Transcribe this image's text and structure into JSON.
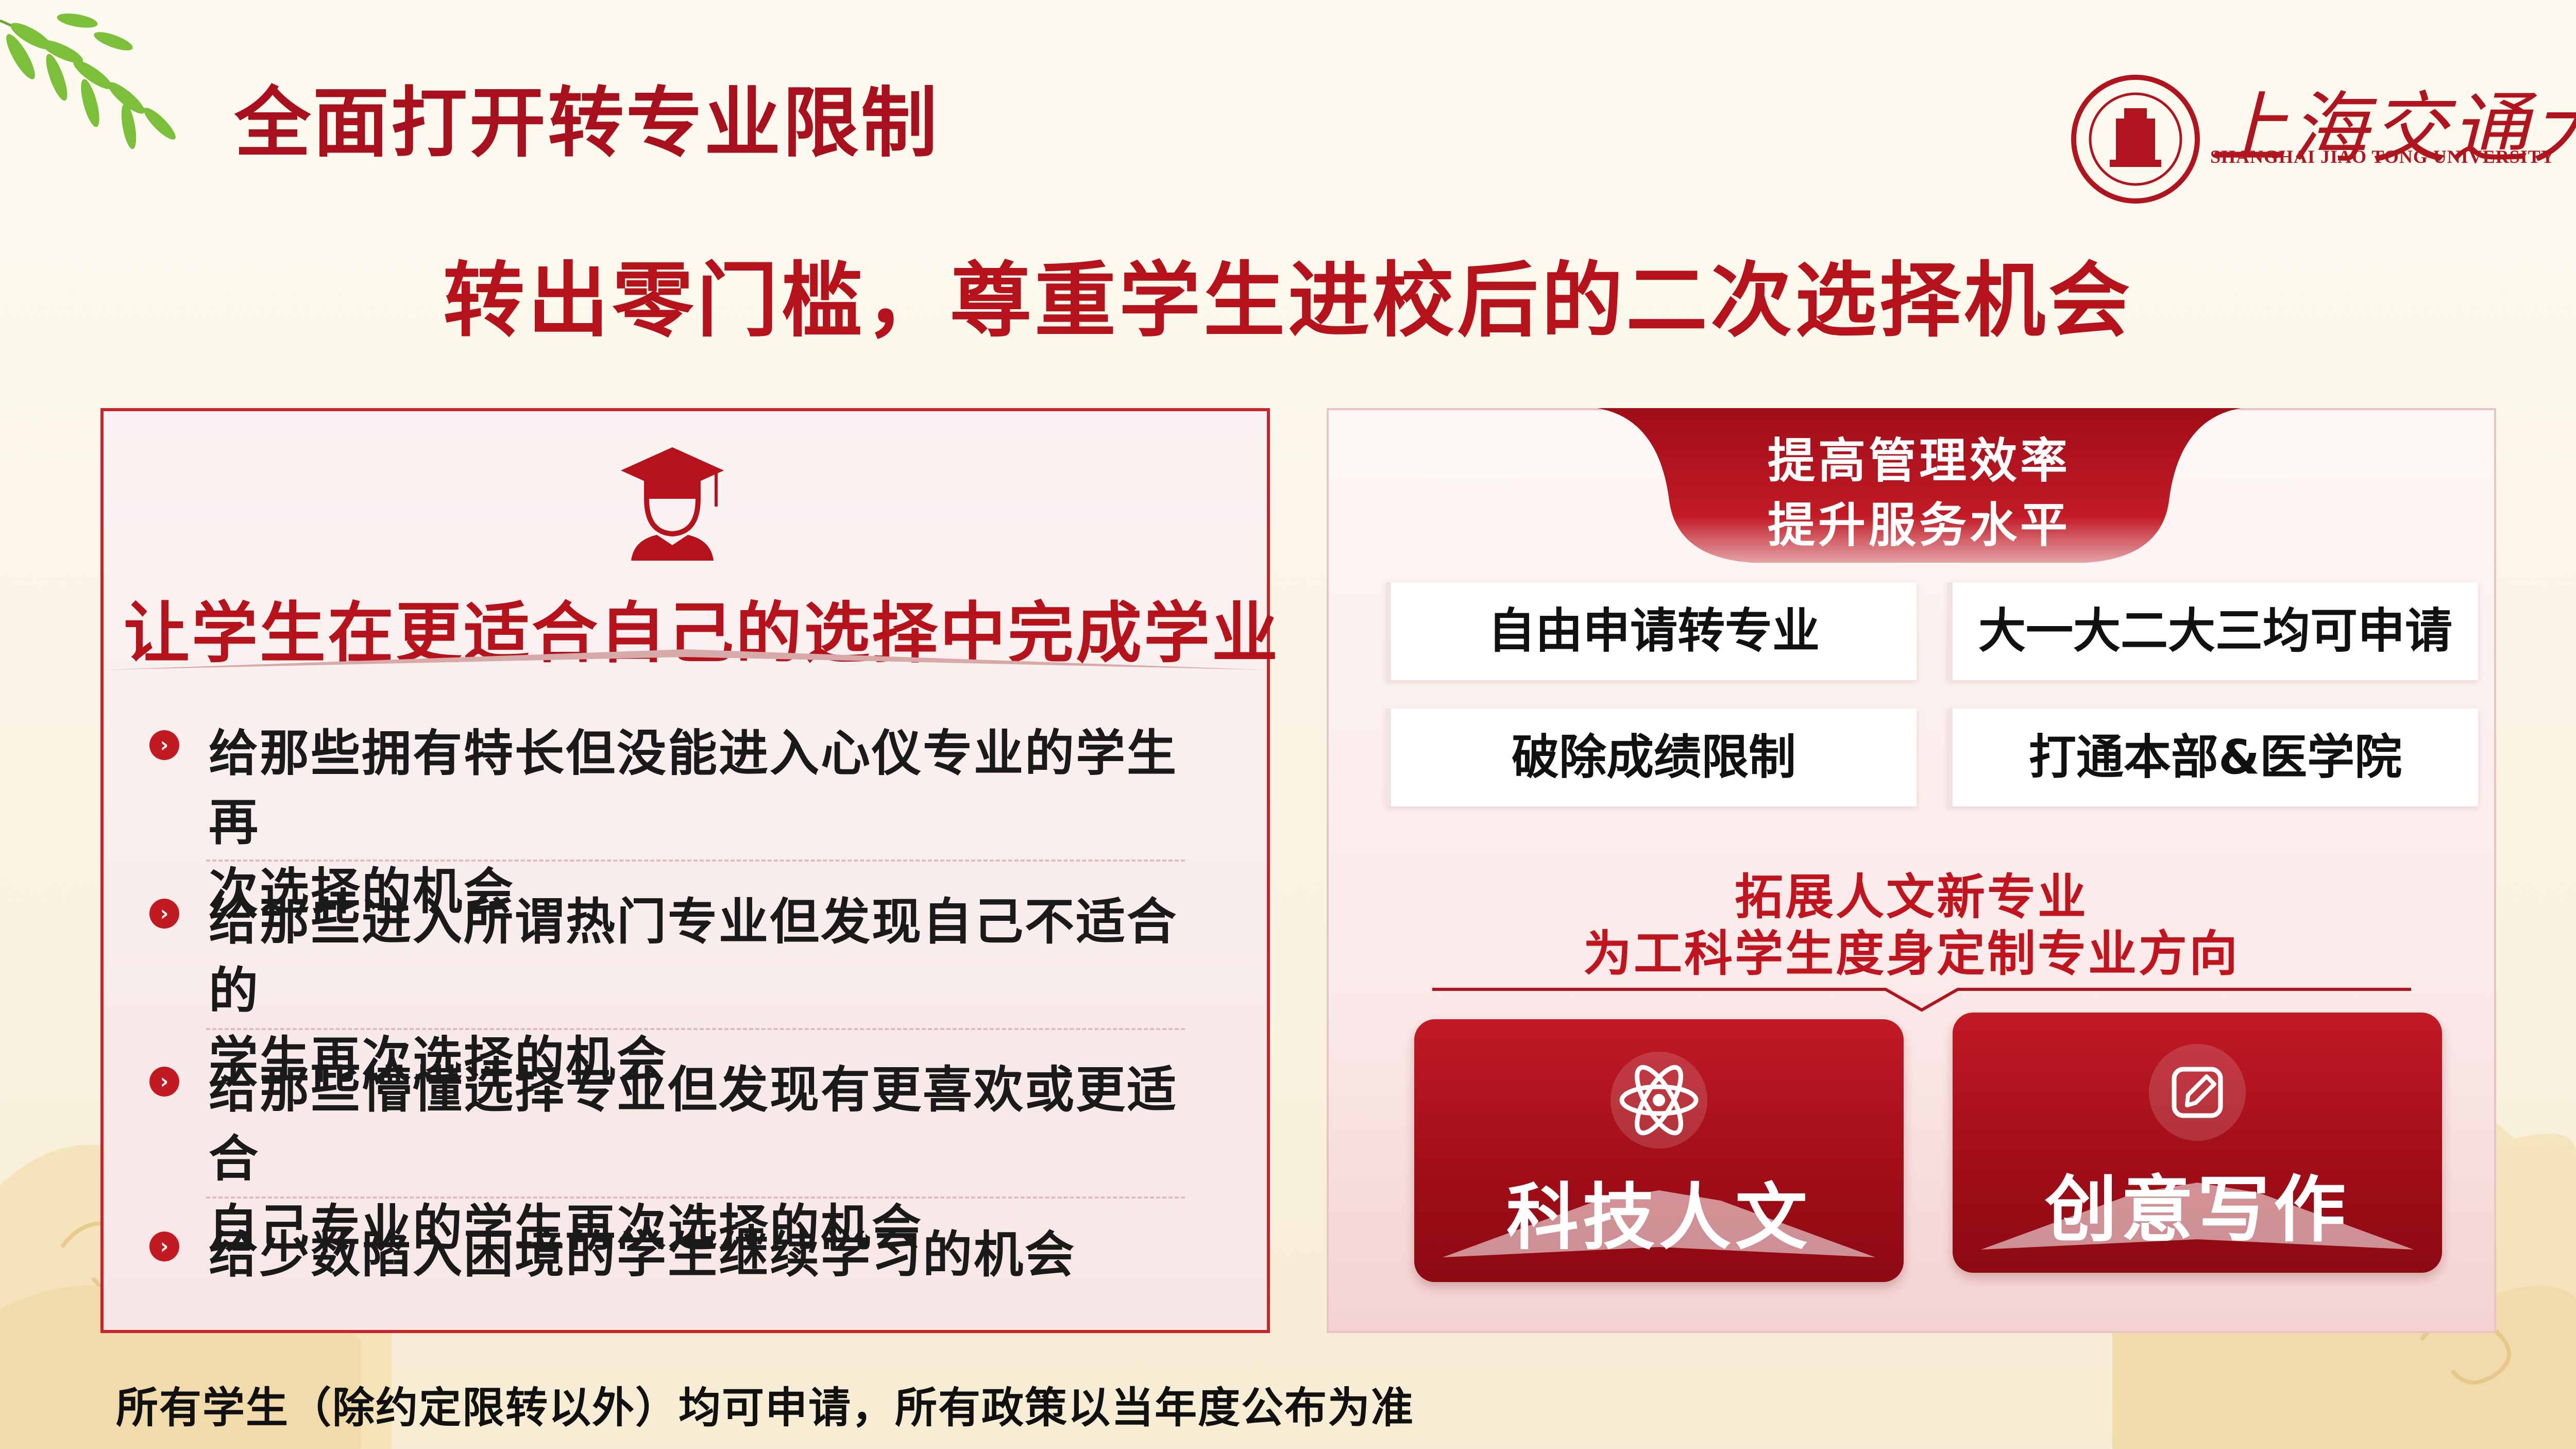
{
  "page_title": "全面打开转专业限制",
  "logo": {
    "name_cn": "上海交通大学",
    "name_en": "SHANGHAI JIAO TONG UNIVERSITY",
    "icon": "university-seal"
  },
  "subtitle": "转出零门槛，尊重学生进校后的二次选择机会",
  "left_panel": {
    "heading": "让学生在更适合自己的选择中完成学业",
    "icon": "graduate-cap",
    "bullets": [
      {
        "line1": "给那些拥有特长但没能进入心仪专业的学生再",
        "line2": "次选择的机会"
      },
      {
        "line1": "给那些进入所谓热门专业但发现自己不适合的",
        "line2": "学生再次选择的机会"
      },
      {
        "line1": "给那些懵懂选择专业但发现有更喜欢或更适合",
        "line2": "自己专业的学生再次选择的机会"
      },
      {
        "line1": "给少数陷入困境的学生继续学习的机会",
        "line2": ""
      }
    ]
  },
  "right_panel": {
    "banner_line1": "提高管理效率",
    "banner_line2": "提升服务水平",
    "features": [
      "自由申请转专业",
      "大一大二大三均可申请",
      "破除成绩限制",
      "打通本部&医学院"
    ],
    "mid_line1": "拓展人文新专业",
    "mid_line2": "为工科学生度身定制专业方向",
    "cards": [
      {
        "label": "科技人文",
        "icon": "atom-icon"
      },
      {
        "label": "创意写作",
        "icon": "pen-square-icon"
      }
    ]
  },
  "footnote": "所有学生（除约定限转以外）均可申请，所有政策以当年度公布为准",
  "colors": {
    "accent": "#b5121b",
    "background": "#fbf5e8"
  }
}
